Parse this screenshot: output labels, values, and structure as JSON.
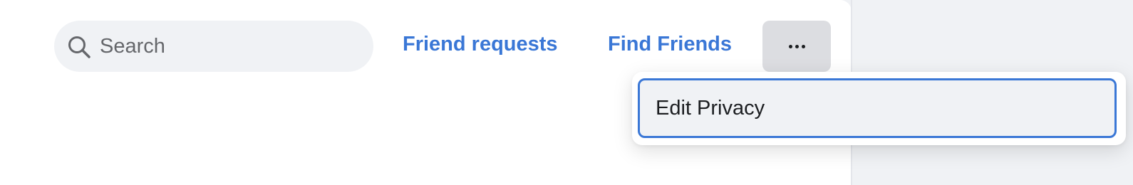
{
  "search": {
    "placeholder": "Search",
    "icon": "search-icon"
  },
  "nav": {
    "friend_requests": "Friend requests",
    "find_friends": "Find Friends",
    "more_icon": "more-horizontal-icon"
  },
  "menu": {
    "items": [
      {
        "label": "Edit Privacy",
        "highlighted": true
      }
    ]
  },
  "colors": {
    "link": "#3a77d6",
    "focus_ring": "#3a77d6",
    "search_bg": "#f0f2f5",
    "more_button_bg": "#dcdde1"
  }
}
